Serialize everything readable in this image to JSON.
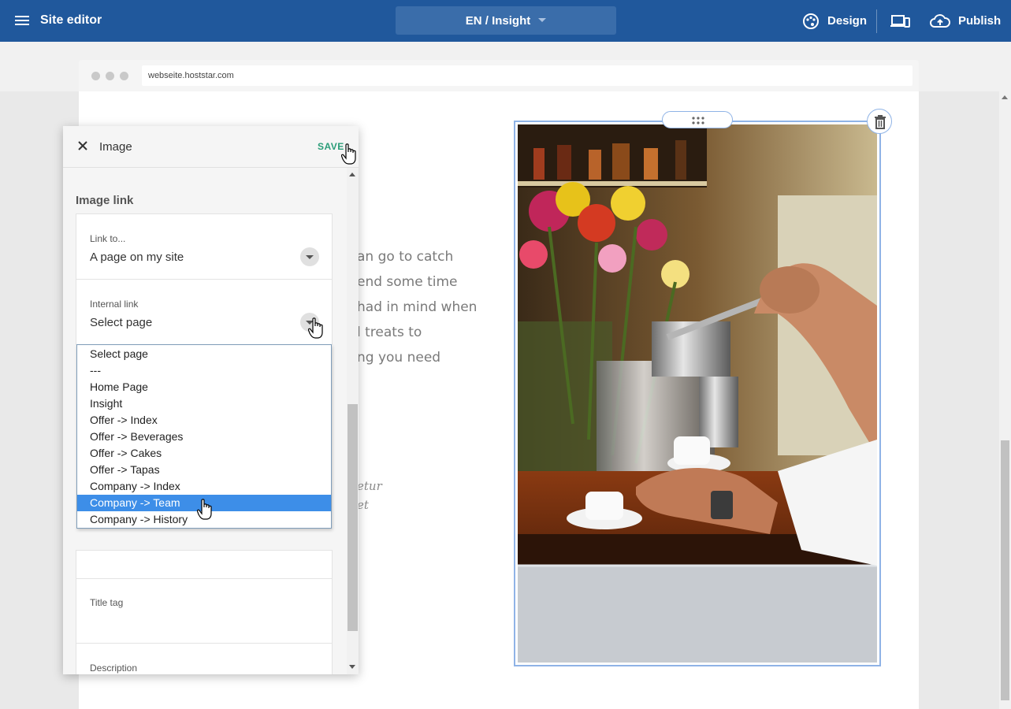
{
  "topbar": {
    "title": "Site editor",
    "language_page": "EN / Insight",
    "design_label": "Design",
    "publish_label": "Publish",
    "background_color": "#20589c"
  },
  "browser": {
    "url": "webseite.hoststar.com"
  },
  "page": {
    "body_lines": [
      "an go to catch",
      "end some time",
      "had in mind when",
      "l treats to",
      "ng you need"
    ],
    "italic_lines": [
      "etur",
      "et"
    ]
  },
  "panel": {
    "title": "Image",
    "save_label": "SAVE",
    "section_title": "Image link",
    "link_to": {
      "label": "Link to...",
      "value": "A page on my site"
    },
    "internal_link": {
      "label": "Internal link",
      "value": "Select page"
    },
    "title_tag": {
      "label": "Title tag"
    },
    "description": {
      "label": "Description"
    }
  },
  "page_options": {
    "options": [
      "Select page",
      "---",
      "Home Page",
      "Insight",
      "Offer -> Index",
      "Offer -> Beverages",
      "Offer -> Cakes",
      "Offer -> Tapas",
      "Company -> Index",
      "Company -> Team",
      "Company -> History"
    ],
    "highlighted": "Company -> Team",
    "highlight_color": "#3d8ee8"
  },
  "colors": {
    "accent_save": "#2a9d78",
    "selection_outline": "#8fb3e6"
  }
}
